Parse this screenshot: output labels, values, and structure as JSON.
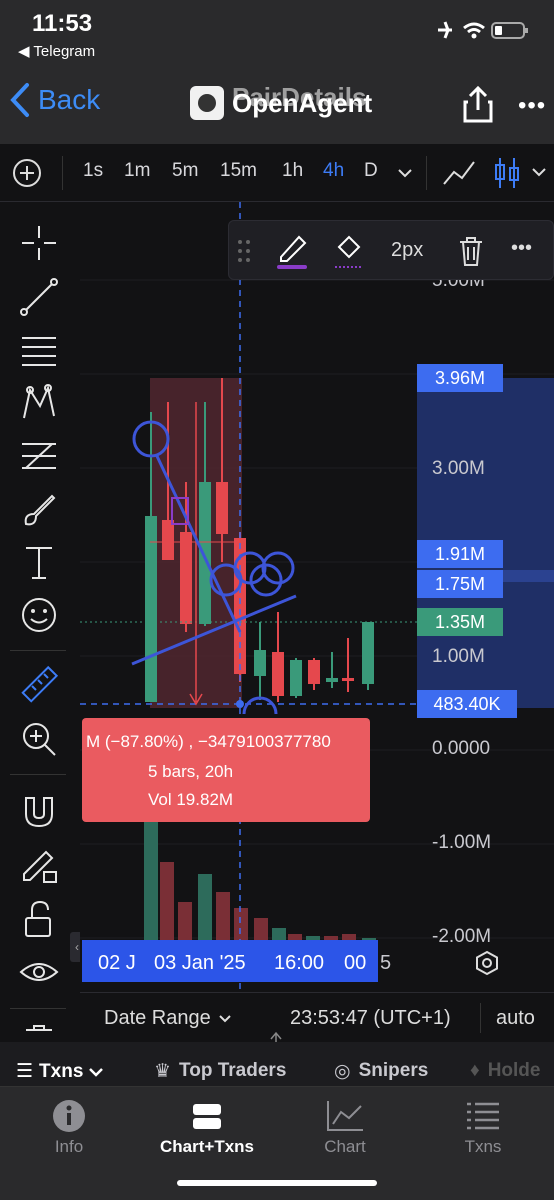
{
  "status": {
    "time": "11:53",
    "back_app": "◀ Telegram"
  },
  "nav": {
    "back_label": "Back",
    "title": "OpenAgent",
    "title_overlay": "PairDetails"
  },
  "timeframes": [
    "1s",
    "1m",
    "5m",
    "15m",
    "1h",
    "4h",
    "D"
  ],
  "active_timeframe": "4h",
  "drawbar": {
    "stroke_label": "2px"
  },
  "price_tags": [
    {
      "label": "3.96M",
      "color": "#3d6cf0"
    },
    {
      "label": "1.91M",
      "color": "#3d6cf0"
    },
    {
      "label": "1.75M",
      "color": "#3d6cf0"
    },
    {
      "label": "1.35M",
      "color": "#3a9a7a"
    },
    {
      "label": "483.40K",
      "color": "#3d6cf0"
    }
  ],
  "axis_labels": [
    "5.00M",
    "3.00M",
    "1.00M",
    "0.0000",
    "-1.00M",
    "-2.00M"
  ],
  "infobox": {
    "line1": "M (−87.80%) , −3479100377780",
    "line2": "5 bars, 20h",
    "line3": "Vol 19.82M"
  },
  "time_axis": {
    "left": "02 J",
    "center": "03 Jan '25",
    "right": "16:00",
    "cut": "00",
    "extra": "5"
  },
  "date_range": {
    "label": "Date Range",
    "clock": "23:53:47 (UTC+1)",
    "mode": "auto"
  },
  "subtabs": [
    "Txns",
    "Top Traders",
    "Snipers",
    "Holde"
  ],
  "tabs": [
    {
      "label": "Info",
      "active": false
    },
    {
      "label": "Chart+Txns",
      "active": true
    },
    {
      "label": "Chart",
      "active": false
    },
    {
      "label": "Txns",
      "active": false
    }
  ],
  "colors": {
    "accent": "#3d7cf6",
    "up": "#3a9a7a",
    "down": "#e5484d",
    "drawing": "#3d55d8"
  }
}
